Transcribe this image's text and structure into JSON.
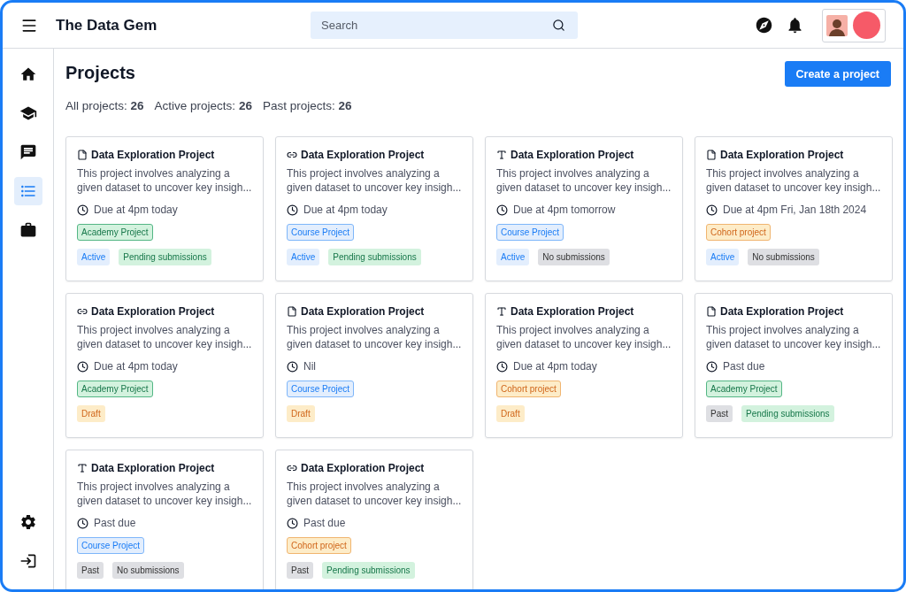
{
  "header": {
    "title": "The Data Gem",
    "search": {
      "placeholder": "Search"
    }
  },
  "sidebar": {
    "items": [
      {
        "kind": "home",
        "selected": false
      },
      {
        "kind": "school",
        "selected": false
      },
      {
        "kind": "chat",
        "selected": false
      },
      {
        "kind": "list",
        "selected": true
      },
      {
        "kind": "work",
        "selected": false
      }
    ],
    "bottom_items": [
      {
        "kind": "settings",
        "selected": false
      },
      {
        "kind": "logout",
        "selected": false
      }
    ]
  },
  "page": {
    "title": "Projects",
    "create_button": "Create a project",
    "stats": [
      {
        "label": "All projects:",
        "value": "26"
      },
      {
        "label": "Active projects:",
        "value": "26"
      },
      {
        "label": "Past projects:",
        "value": "26"
      }
    ]
  },
  "projects": [
    {
      "kind": "file",
      "title": "Data Exploration Project",
      "description": "This project involves analyzing a given dataset to uncover key insigh...",
      "due": "Due at 4pm today",
      "type": {
        "label": "Academy Project",
        "kind": "academy"
      },
      "badges": [
        {
          "label": "Active",
          "kind": "active"
        },
        {
          "label": "Pending submissions",
          "kind": "pending"
        }
      ]
    },
    {
      "kind": "link",
      "title": "Data Exploration Project",
      "description": "This project involves analyzing a given dataset to uncover key insigh...",
      "due": "Due at 4pm today",
      "type": {
        "label": "Course Project",
        "kind": "course"
      },
      "badges": [
        {
          "label": "Active",
          "kind": "active"
        },
        {
          "label": "Pending submissions",
          "kind": "pending"
        }
      ]
    },
    {
      "kind": "text",
      "title": "Data Exploration Project",
      "description": "This project involves analyzing a given dataset to uncover key insigh...",
      "due": "Due at 4pm tomorrow",
      "type": {
        "label": "Course Project",
        "kind": "course"
      },
      "badges": [
        {
          "label": "Active",
          "kind": "active"
        },
        {
          "label": "No submissions",
          "kind": "none"
        }
      ]
    },
    {
      "kind": "file",
      "title": "Data Exploration Project",
      "description": "This project involves analyzing a given dataset to uncover key insigh...",
      "due": "Due at 4pm Fri, Jan 18th 2024",
      "type": {
        "label": "Cohort project",
        "kind": "cohort"
      },
      "badges": [
        {
          "label": "Active",
          "kind": "active"
        },
        {
          "label": "No submissions",
          "kind": "none"
        }
      ]
    },
    {
      "kind": "link",
      "title": "Data Exploration Project",
      "description": "This project involves analyzing a given dataset to uncover key insigh...",
      "due": "Due at 4pm today",
      "type": {
        "label": "Academy Project",
        "kind": "academy"
      },
      "badges": [
        {
          "label": "Draft",
          "kind": "draft"
        }
      ]
    },
    {
      "kind": "file",
      "title": "Data Exploration Project",
      "description": "This project involves analyzing a given dataset to uncover key insigh...",
      "due": "Nil",
      "type": {
        "label": "Course Project",
        "kind": "course"
      },
      "badges": [
        {
          "label": "Draft",
          "kind": "draft"
        }
      ]
    },
    {
      "kind": "text",
      "title": "Data Exploration Project",
      "description": "This project involves analyzing a given dataset to uncover key insigh...",
      "due": "Due at 4pm today",
      "type": {
        "label": "Cohort project",
        "kind": "cohort"
      },
      "badges": [
        {
          "label": "Draft",
          "kind": "draft"
        }
      ]
    },
    {
      "kind": "file",
      "title": "Data Exploration Project",
      "description": "This project involves analyzing a given dataset to uncover key insigh...",
      "due": "Past due",
      "type": {
        "label": "Academy Project",
        "kind": "academy"
      },
      "badges": [
        {
          "label": "Past",
          "kind": "past"
        },
        {
          "label": "Pending submissions",
          "kind": "pending"
        }
      ]
    },
    {
      "kind": "text",
      "title": "Data Exploration Project",
      "description": "This project involves analyzing a given dataset to uncover key insigh...",
      "due": "Past due",
      "type": {
        "label": "Course Project",
        "kind": "course"
      },
      "badges": [
        {
          "label": "Past",
          "kind": "past"
        },
        {
          "label": "No submissions",
          "kind": "none"
        }
      ]
    },
    {
      "kind": "link",
      "title": "Data Exploration Project",
      "description": "This project involves analyzing a given dataset to uncover key insigh...",
      "due": "Past due",
      "type": {
        "label": "Cohort project",
        "kind": "cohort"
      },
      "badges": [
        {
          "label": "Past",
          "kind": "past"
        },
        {
          "label": "Pending submissions",
          "kind": "pending"
        }
      ]
    }
  ]
}
